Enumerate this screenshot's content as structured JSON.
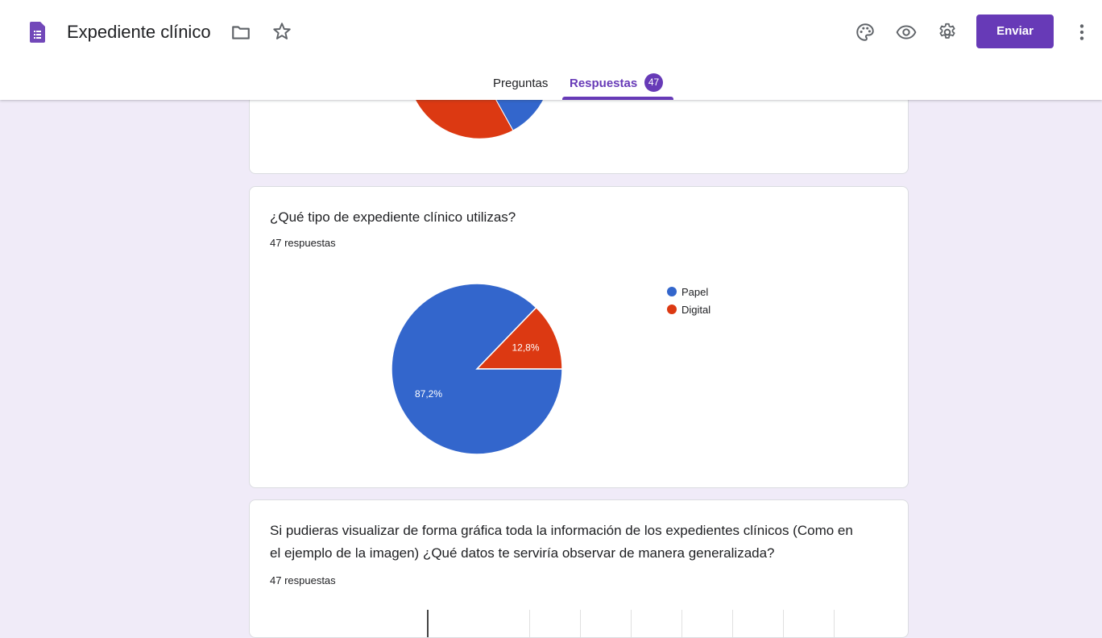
{
  "app": {
    "title": "Expediente clínico",
    "send_label": "Enviar",
    "brand_color": "#673ab7"
  },
  "tabs": [
    {
      "label": "Preguntas"
    },
    {
      "label": "Respuestas",
      "badge": "47",
      "selected": true
    }
  ],
  "icons": [
    "forms-logo-icon",
    "folder-icon",
    "star-icon",
    "palette-icon",
    "eye-icon",
    "gear-icon",
    "more-vert-icon"
  ],
  "questions": [
    {
      "title": "¿Qué tipo de expediente clínico utilizas?",
      "count": "47 respuestas",
      "chart_data": {
        "type": "pie",
        "legend_position": "right",
        "slices": [
          {
            "label": "Papel",
            "value": 87.2,
            "display": "87,2%",
            "color": "#3366cc"
          },
          {
            "label": "Digital",
            "value": 12.8,
            "display": "12,8%",
            "color": "#dc3912"
          }
        ]
      }
    },
    {
      "title": "Si pudieras visualizar de forma gráfica toda la información de los expedientes clínicos (Como en el ejemplo de la imagen) ¿Qué datos te serviría observar de manera generalizada?",
      "count": "47 respuestas"
    }
  ]
}
